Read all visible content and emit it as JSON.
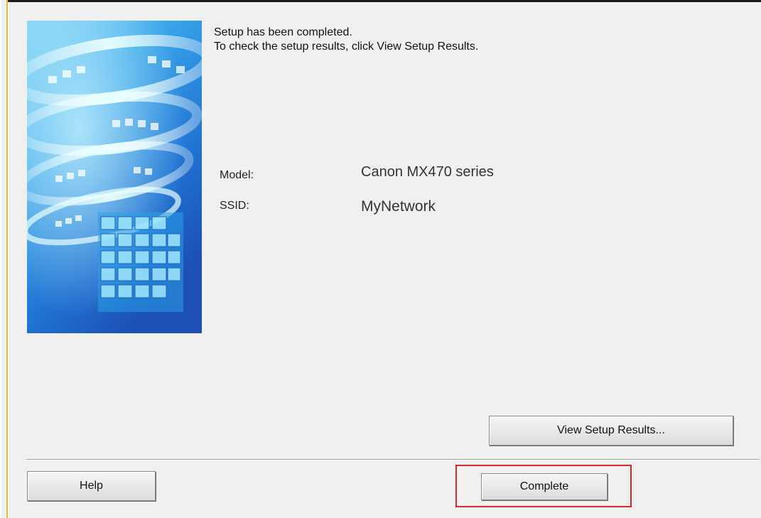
{
  "message": {
    "line1": "Setup has been completed.",
    "line2": "To check the setup results, click View Setup Results."
  },
  "info": {
    "model_label": "Model:",
    "model_value": "Canon MX470 series",
    "ssid_label": "SSID:",
    "ssid_value": "MyNetwork"
  },
  "buttons": {
    "view_results": "View Setup Results...",
    "help": "Help",
    "complete": "Complete"
  },
  "colors": {
    "highlight": "#e0262f",
    "art_blue": "#1e7fd0"
  }
}
